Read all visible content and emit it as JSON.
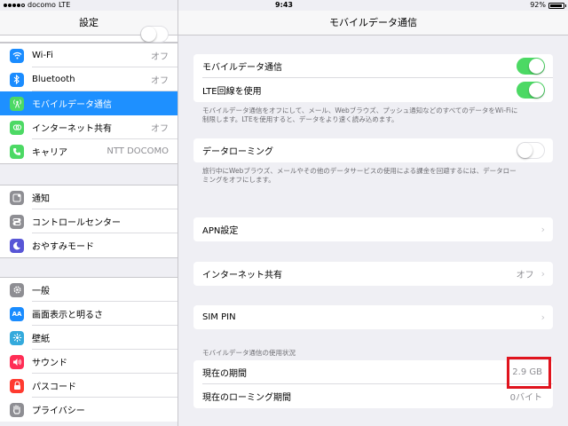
{
  "status_bar": {
    "carrier": "docomo",
    "network": "LTE",
    "time": "9:43",
    "battery": "92%",
    "battery_level": 0.92
  },
  "sidebar": {
    "title": "設定",
    "group1": [
      {
        "label": "Wi-Fi",
        "value": "オフ",
        "icon": "wifi-icon",
        "color": "#1a8cff"
      },
      {
        "label": "Bluetooth",
        "value": "オフ",
        "icon": "bluetooth-icon",
        "color": "#1a8cff"
      },
      {
        "label": "モバイルデータ通信",
        "value": "",
        "icon": "antenna-icon",
        "color": "#4cd964",
        "selected": true
      },
      {
        "label": "インターネット共有",
        "value": "オフ",
        "icon": "link-icon",
        "color": "#4cd964"
      },
      {
        "label": "キャリア",
        "value": "NTT DOCOMO",
        "icon": "phone-icon",
        "color": "#4cd964"
      }
    ],
    "group2": [
      {
        "label": "通知",
        "icon": "notification-icon",
        "color": "#8e8e93"
      },
      {
        "label": "コントロールセンター",
        "icon": "control-center-icon",
        "color": "#8e8e93"
      },
      {
        "label": "おやすみモード",
        "icon": "moon-icon",
        "color": "#5856d6"
      }
    ],
    "group3": [
      {
        "label": "一般",
        "icon": "gear-icon",
        "color": "#8e8e93"
      },
      {
        "label": "画面表示と明るさ",
        "icon": "display-icon",
        "color": "#1a8cff"
      },
      {
        "label": "壁紙",
        "icon": "wallpaper-icon",
        "color": "#34aadc"
      },
      {
        "label": "サウンド",
        "icon": "sound-icon",
        "color": "#ff2d55"
      },
      {
        "label": "パスコード",
        "icon": "lock-icon",
        "color": "#ff3b30"
      },
      {
        "label": "プライバシー",
        "icon": "hand-icon",
        "color": "#8e8e93"
      }
    ]
  },
  "main": {
    "title": "モバイルデータ通信",
    "cellular": {
      "label": "モバイルデータ通信",
      "on": true
    },
    "lte": {
      "label": "LTE回線を使用",
      "on": true
    },
    "cellular_note_1": "モバイルデータ通信をオフにして、メール、Webブラウズ、プッシュ通知などのすべてのデータをWi-Fiに",
    "cellular_note_2": "制限します。LTEを使用すると、データをより速く読み込めます。",
    "roaming": {
      "label": "データローミング",
      "on": false
    },
    "roaming_note_1": "旅行中にWebブラウズ、メールやその他のデータサービスの使用による課金を回避するには、データロー",
    "roaming_note_2": "ミングをオフにします。",
    "apn": {
      "label": "APN設定"
    },
    "hotspot": {
      "label": "インターネット共有",
      "value": "オフ"
    },
    "simpin": {
      "label": "SIM PIN"
    },
    "usage_header": "モバイルデータ通信の使用状況",
    "usage_current": {
      "label": "現在の期間",
      "value": "2.9 GB"
    },
    "usage_roaming": {
      "label": "現在のローミング期間",
      "value": "0バイト"
    }
  }
}
